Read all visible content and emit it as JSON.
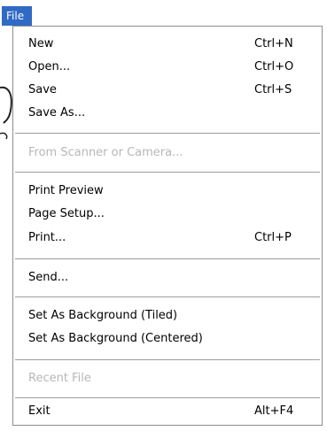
{
  "menubar": {
    "file_label": "File"
  },
  "menu": {
    "items": [
      {
        "label": "New",
        "shortcut": "Ctrl+N"
      },
      {
        "label": "Open...",
        "shortcut": "Ctrl+O"
      },
      {
        "label": "Save",
        "shortcut": "Ctrl+S"
      },
      {
        "label": "Save As...",
        "shortcut": ""
      },
      {
        "label": "From Scanner or Camera...",
        "shortcut": ""
      },
      {
        "label": "Print Preview",
        "shortcut": ""
      },
      {
        "label": "Page Setup...",
        "shortcut": ""
      },
      {
        "label": "Print...",
        "shortcut": "Ctrl+P"
      },
      {
        "label": "Send...",
        "shortcut": ""
      },
      {
        "label": "Set As Background (Tiled)",
        "shortcut": ""
      },
      {
        "label": "Set As Background (Centered)",
        "shortcut": ""
      },
      {
        "label": "Recent File",
        "shortcut": ""
      },
      {
        "label": "Exit",
        "shortcut": "Alt+F4"
      }
    ]
  },
  "colors": {
    "highlight": "#316ac5",
    "disabled_text": "#b7b7b7",
    "separator": "#9d9d9d"
  }
}
